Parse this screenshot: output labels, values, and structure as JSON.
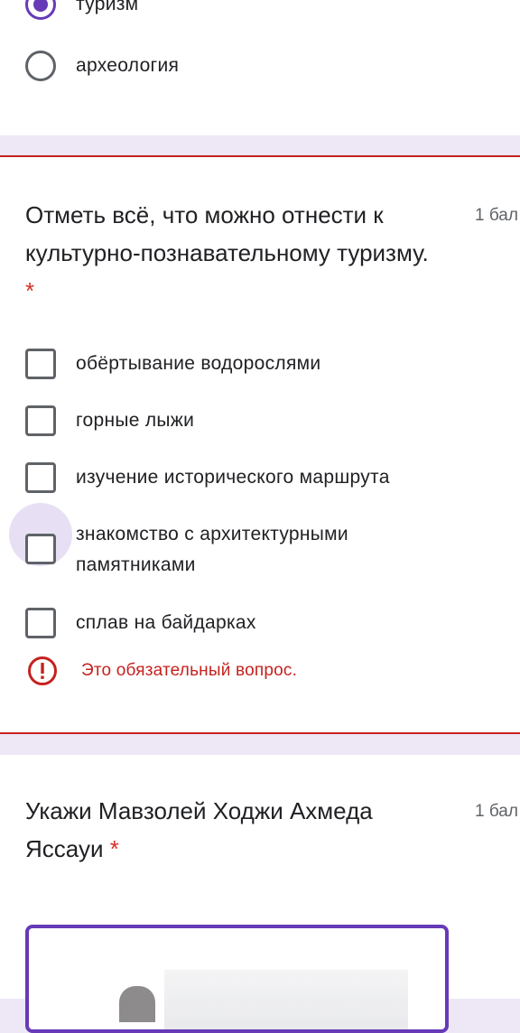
{
  "prev_question": {
    "options": [
      {
        "label": "туризм",
        "selected": true
      },
      {
        "label": "археология",
        "selected": false
      }
    ]
  },
  "question1": {
    "title": "Отметь всё, что можно отнести к культурно-познавательному туризму.",
    "required_mark": "*",
    "points": "1 бал",
    "options": [
      {
        "label": "обёртывание водорослями",
        "checked": false
      },
      {
        "label": "горные лыжи",
        "checked": false
      },
      {
        "label": "изучение исторического маршрута",
        "checked": false
      },
      {
        "label": "знакомство с архитектурными памятниками",
        "checked": false,
        "focused": true
      },
      {
        "label": "сплав на байдарках",
        "checked": false
      }
    ],
    "error": "Это обязательный вопрос."
  },
  "question2": {
    "title": "Укажи Мавзолей Ходжи Ахмеда Яссауи",
    "required_mark": "*",
    "points": "1 бал"
  },
  "colors": {
    "accent": "#673ab7",
    "error": "#c5221f",
    "background": "#ede7f6"
  }
}
